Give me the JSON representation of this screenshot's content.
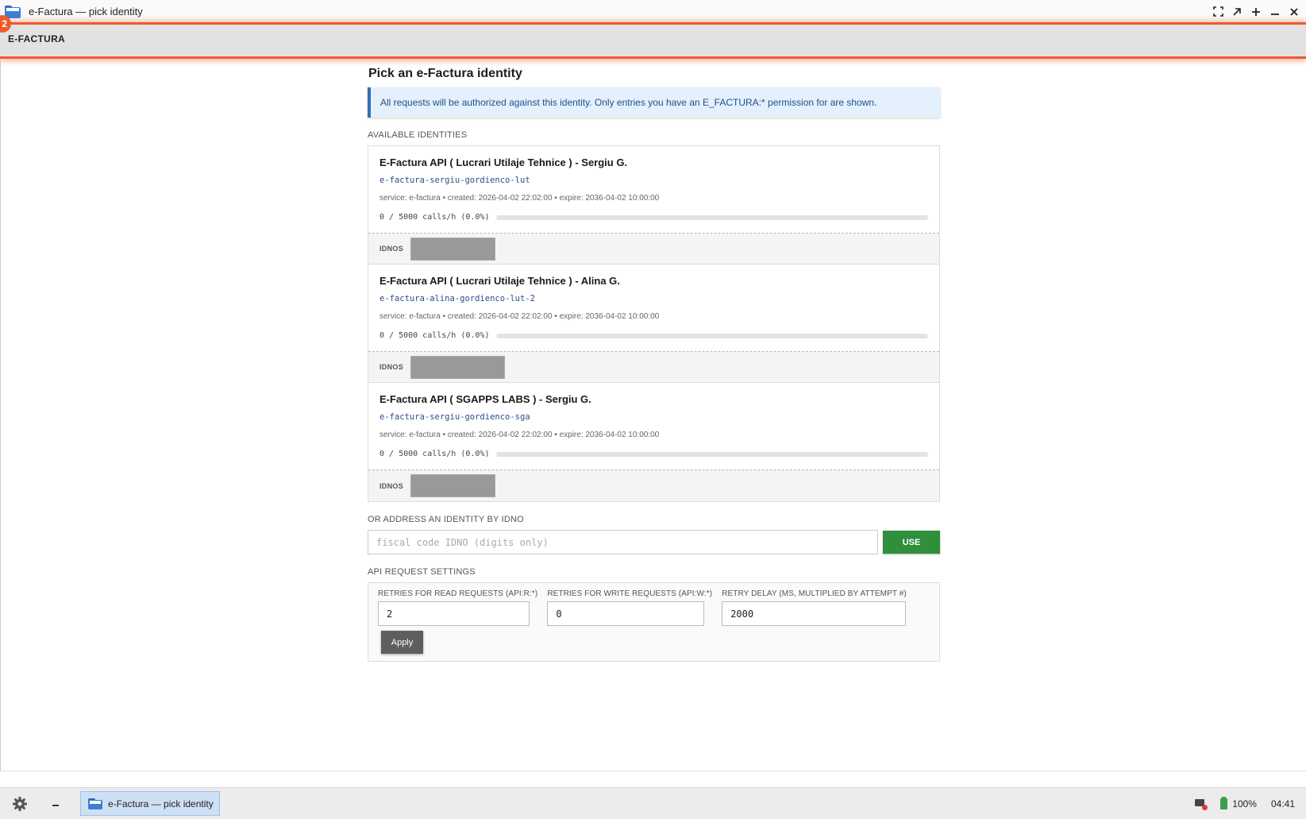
{
  "window": {
    "title": "e-Factura — pick identity",
    "controls": [
      "fullscreen-icon",
      "restore-icon",
      "maximize-icon",
      "minimize-icon",
      "close-icon"
    ]
  },
  "header": {
    "brand": "E-FACTURA",
    "badge_count": "2"
  },
  "page": {
    "title": "Pick an e-Factura identity",
    "notice": "All requests will be authorized against this identity. Only entries you have an E_FACTURA:* permission for are shown.",
    "available_label": "AVAILABLE IDENTITIES"
  },
  "identities": [
    {
      "name": "E-Factura API ( Lucrari Utilaje Tehnice ) - Sergiu G.",
      "slug": "e-factura-sergiu-gordienco-lut",
      "meta": "service: e-factura • created: 2026-04-02 22:02:00 • expire: 2036-04-02 10:00:00",
      "usage": "0 / 5000 calls/h (0.0%)",
      "usage_fraction": 0.0,
      "idnos_label": "IDNOS"
    },
    {
      "name": "E-Factura API ( Lucrari Utilaje Tehnice ) - Alina G.",
      "slug": "e-factura-alina-gordienco-lut-2",
      "meta": "service: e-factura • created: 2026-04-02 22:02:00 • expire: 2036-04-02 10:00:00",
      "usage": "0 / 5000 calls/h (0.0%)",
      "usage_fraction": 0.0,
      "idnos_label": "IDNOS"
    },
    {
      "name": "E-Factura API ( SGAPPS LABS ) - Sergiu G.",
      "slug": "e-factura-sergiu-gordienco-sga",
      "meta": "service: e-factura • created: 2026-04-02 22:02:00 • expire: 2036-04-02 10:00:00",
      "usage": "0 / 5000 calls/h (0.0%)",
      "usage_fraction": 0.0,
      "idnos_label": "IDNOS"
    }
  ],
  "idno": {
    "label": "OR ADDRESS AN IDENTITY BY IDNO",
    "placeholder": "fiscal code IDNO (digits only)",
    "value": "",
    "button": "USE"
  },
  "settings": {
    "label": "API REQUEST SETTINGS",
    "read_label": "RETRIES FOR READ REQUESTS (API:R:*)",
    "read_value": "2",
    "write_label": "RETRIES FOR WRITE REQUESTS (API:W:*)",
    "write_value": "0",
    "delay_label": "RETRY DELAY (MS, MULTIPLIED BY ATTEMPT #)",
    "delay_value": "2000",
    "apply": "Apply"
  },
  "taskbar": {
    "task_label": "e-Factura — pick identity",
    "battery": "100%",
    "clock": "04:41"
  },
  "colors": {
    "accent": "#f05a28",
    "info": "#2f6fb8",
    "use_button": "#2f8f3a",
    "apply_button": "#5e5e5e"
  }
}
